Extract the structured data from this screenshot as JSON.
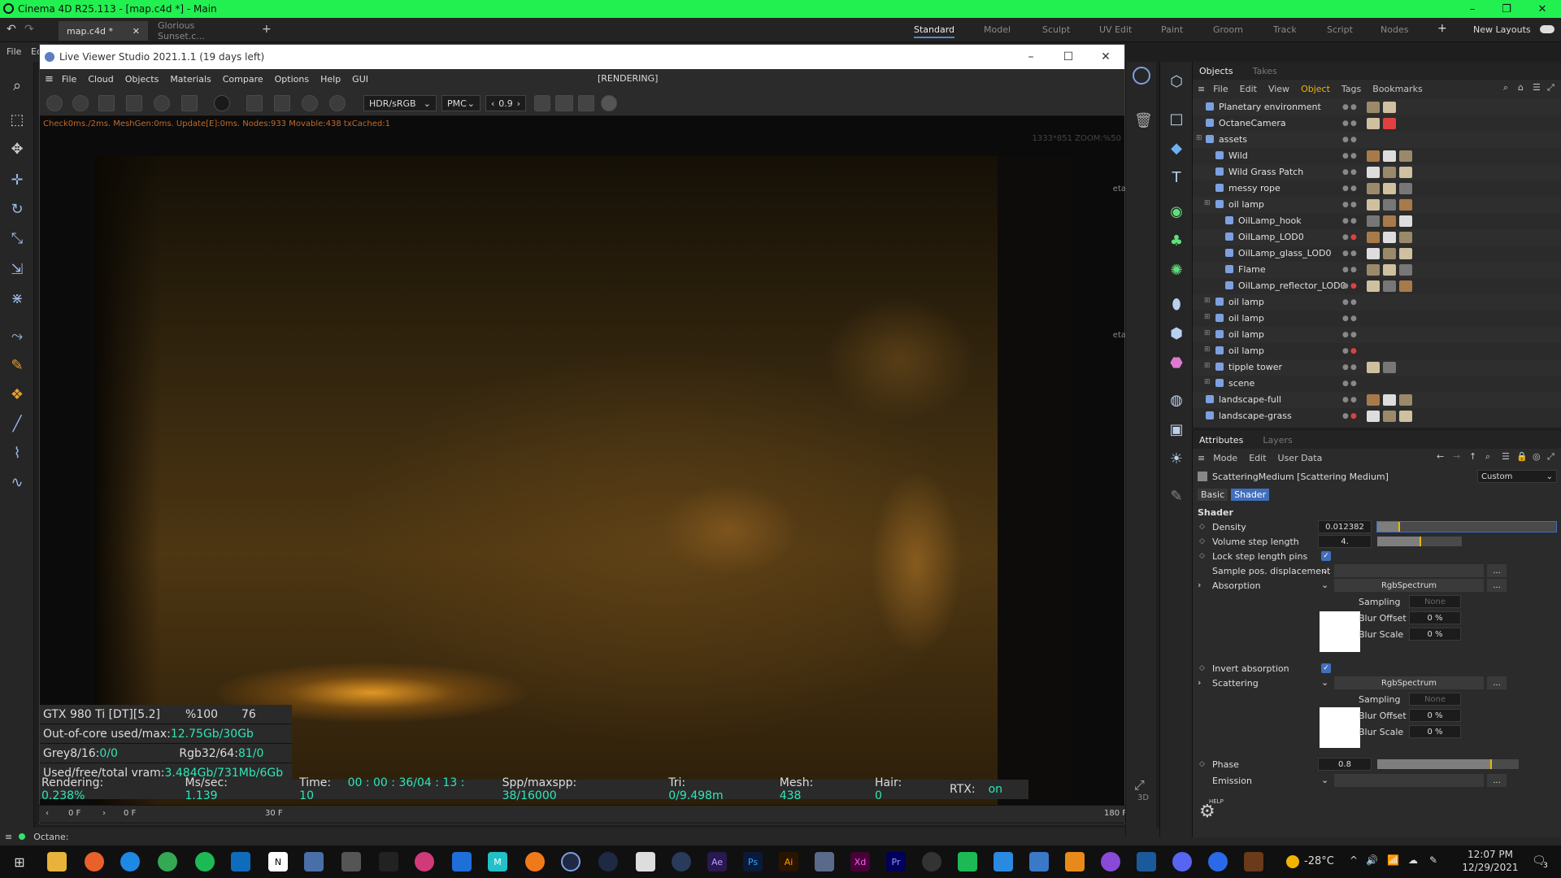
{
  "window": {
    "title": "Cinema 4D R25.113 - [map.c4d *] - Main",
    "minimize": "–",
    "maximize": "❐",
    "close": "✕"
  },
  "tabs": {
    "active": "map.c4d *",
    "second": "Glorious Sunset.c...",
    "close": "✕",
    "add": "+"
  },
  "layouts": [
    "Standard",
    "Model",
    "Sculpt",
    "UV Edit",
    "Paint",
    "Groom",
    "Track",
    "Script",
    "Nodes"
  ],
  "layouts_extra": {
    "add": "+",
    "new": "New Layouts"
  },
  "c4d_menu": {
    "file": "File",
    "edit": "Ed"
  },
  "liveviewer": {
    "title": "Live Viewer Studio 2021.1.1 (19 days left)",
    "menu": [
      "File",
      "Cloud",
      "Objects",
      "Materials",
      "Compare",
      "Options",
      "Help",
      "GUI"
    ],
    "rendering_label": "[RENDERING]",
    "hdr_select": "HDR/sRGB",
    "pmc_select": "PMC",
    "value": "0.9",
    "info": "Check0ms./2ms. MeshGen:0ms. Update[E]:0ms. Nodes:933 Movable:438 txCached:1",
    "zoom": "1333*851 ZOOM:%50",
    "side_labels": [
      "eta",
      "eta"
    ],
    "stats": {
      "gpu": "GTX 980 Ti [DT][5.2]",
      "pct": "%100",
      "temp": "76",
      "ooc_label": "Out-of-core used/max:",
      "ooc_value": "12.75Gb/30Gb",
      "grey_label": "Grey8/16: ",
      "grey_value": "0/0",
      "rgb_label": "Rgb32/64: ",
      "rgb_value": "81/0",
      "vram_label": "Used/free/total vram: ",
      "vram_value": "3.484Gb/731Mb/6Gb"
    },
    "status": {
      "rendering_label": "Rendering: ",
      "rendering_value": "0.238%",
      "ms_label": "Ms/sec: ",
      "ms_value": "1.139",
      "time_label": "Time: ",
      "time_value": "00 : 00 : 36/04 : 13 : 10",
      "spp_label": "Spp/maxspp: ",
      "spp_value": "38/16000",
      "tri_label": "Tri: ",
      "tri_value": "0/9.498m",
      "mesh_label": "Mesh: ",
      "mesh_value": "438",
      "hair_label": "Hair: ",
      "hair_value": "0",
      "rtx_label": "RTX:",
      "rtx_value": "on"
    }
  },
  "timeline": {
    "start": "0 F",
    "cur": "0 F",
    "mark": "30 F",
    "end": "180 F",
    "frame3d": "3D"
  },
  "octane_status": "Octane:",
  "objects": {
    "tabs": [
      "Objects",
      "Takes"
    ],
    "menu": [
      "File",
      "Edit",
      "View",
      "Object",
      "Tags",
      "Bookmarks"
    ],
    "rows": [
      {
        "name": "Planetary environment",
        "indent": 0
      },
      {
        "name": "OctaneCamera",
        "indent": 0
      },
      {
        "name": "assets",
        "indent": 0
      },
      {
        "name": "Wild",
        "indent": 1
      },
      {
        "name": "Wild Grass Patch",
        "indent": 1
      },
      {
        "name": "messy rope",
        "indent": 1
      },
      {
        "name": "oil lamp",
        "indent": 1
      },
      {
        "name": "OilLamp_hook",
        "indent": 2
      },
      {
        "name": "OilLamp_LOD0",
        "indent": 2
      },
      {
        "name": "OilLamp_glass_LOD0",
        "indent": 2
      },
      {
        "name": "Flame",
        "indent": 2
      },
      {
        "name": "OilLamp_reflector_LOD0",
        "indent": 2
      },
      {
        "name": "oil lamp",
        "indent": 1
      },
      {
        "name": "oil lamp",
        "indent": 1
      },
      {
        "name": "oil lamp",
        "indent": 1
      },
      {
        "name": "oil lamp",
        "indent": 1
      },
      {
        "name": "tipple tower",
        "indent": 1
      },
      {
        "name": "scene",
        "indent": 1
      },
      {
        "name": "landscape-full",
        "indent": 0
      },
      {
        "name": "landscape-grass",
        "indent": 0
      }
    ]
  },
  "attributes": {
    "tabs": [
      "Attributes",
      "Layers"
    ],
    "menu": [
      "Mode",
      "Edit",
      "User Data"
    ],
    "object": "ScatteringMedium [Scattering Medium]",
    "preset": "Custom",
    "subtabs": [
      "Basic",
      "Shader"
    ],
    "section": "Shader",
    "density_label": "Density",
    "density_value": "0.012382",
    "density_level": 0.12,
    "step_label": "Volume step length",
    "step_value": "4.",
    "step_level": 0.5,
    "lock_label": "Lock step length pins",
    "sample_label": "Sample pos. displacement",
    "absorption_label": "Absorption",
    "absorption_value": "RgbSpectrum",
    "sampling_label": "Sampling",
    "sampling_value": "None",
    "blur_offset_label": "Blur Offset",
    "blur_offset_value": "0 %",
    "blur_scale_label": "Blur Scale",
    "blur_scale_value": "0 %",
    "invert_label": "Invert absorption",
    "scattering_label": "Scattering",
    "scattering_value": "RgbSpectrum",
    "phase_label": "Phase",
    "phase_value": "0.8",
    "phase_level": 0.8,
    "emission_label": "Emission",
    "help": "HELP",
    "more": "..."
  },
  "taskbar": {
    "temp": "-28°C",
    "time": "12:07 PM",
    "date": "12/29/2021",
    "badge": "3"
  },
  "colors": {
    "titlebar": "#22f050",
    "accent": "#2ee6b8",
    "orange_info": "#c26a2a",
    "slider_knob": "#e6b800",
    "checkbox": "#3f6fbd"
  }
}
